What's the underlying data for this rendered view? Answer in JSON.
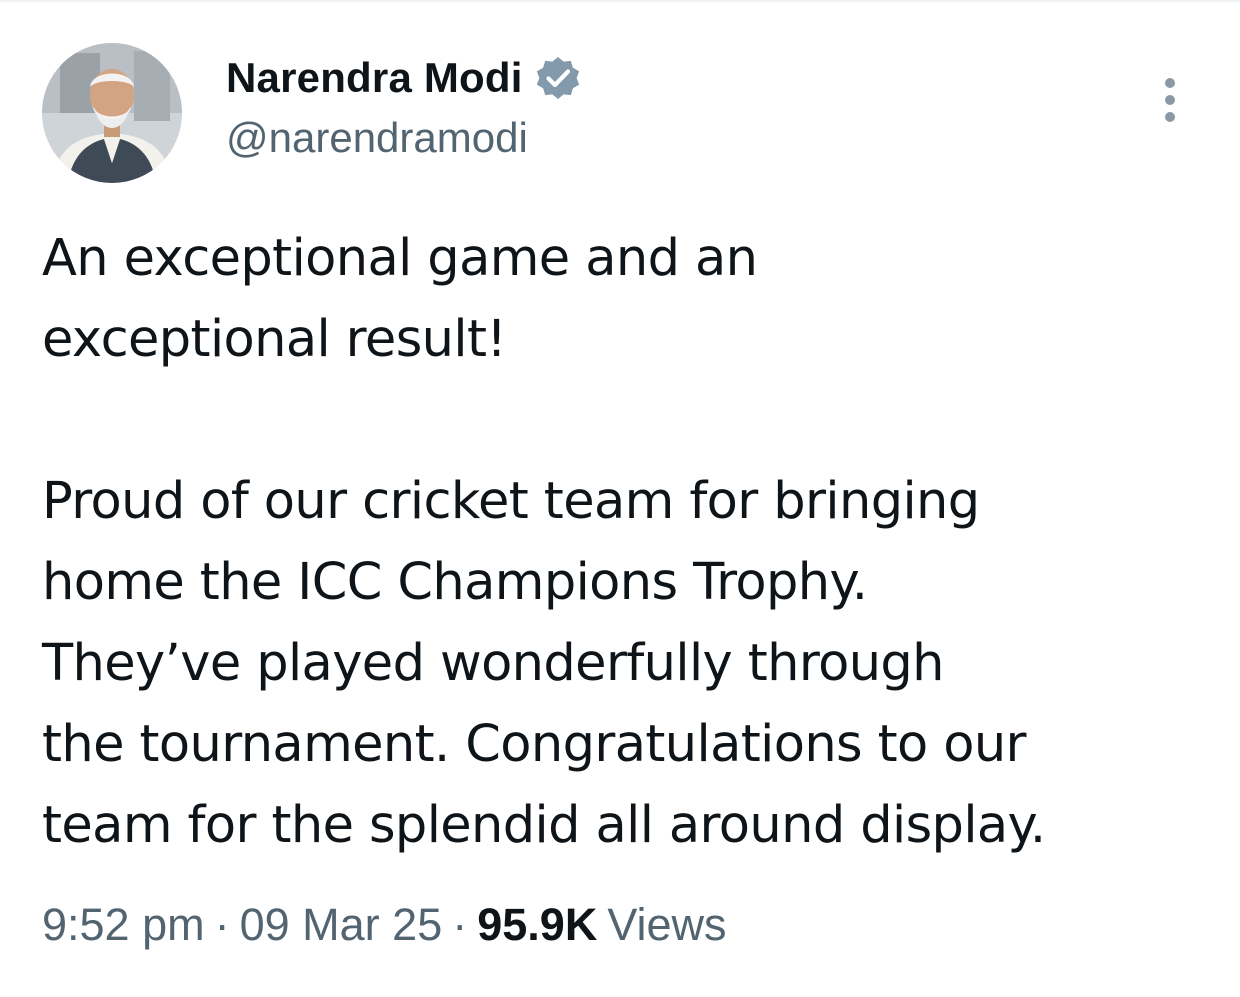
{
  "colors": {
    "text_primary": "#0f1419",
    "text_secondary": "#536471",
    "verified_badge": "#829aab",
    "more_dots": "#8b98a5"
  },
  "author": {
    "avatar_icon": "profile-photo",
    "display_name": "Narendra Modi",
    "verified_icon": "verified-badge-icon",
    "handle": "@narendramodi"
  },
  "actions": {
    "more_icon": "more-vertical-icon"
  },
  "tweet": {
    "paragraph_1": "An exceptional game and an\nexceptional result!",
    "paragraph_2": "Proud of our cricket team for bringing\nhome the ICC Champions Trophy.\nThey’ve played wonderfully through\nthe tournament. Congratulations to our\nteam for the splendid all around display."
  },
  "meta": {
    "time": "9:52 pm",
    "separator": "·",
    "date": "09 Mar 25",
    "views_count": "95.9K",
    "views_label": "Views"
  }
}
